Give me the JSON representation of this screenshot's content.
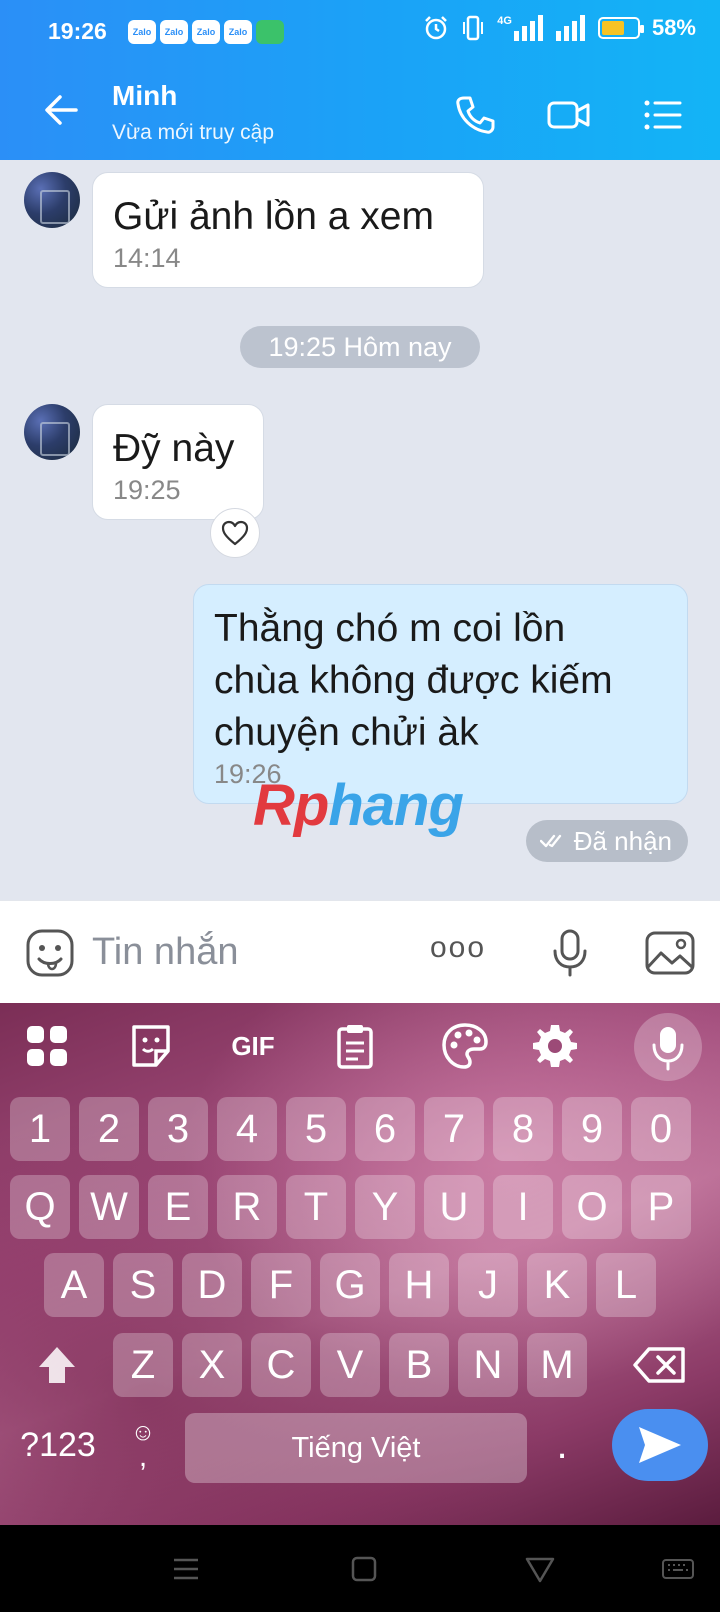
{
  "status_bar": {
    "time": "19:26",
    "notification_apps": [
      "Zalo",
      "Zalo",
      "Zalo",
      "Zalo"
    ],
    "network": "4G",
    "battery": "58%",
    "battery_level": 0.58
  },
  "header": {
    "contact_name": "Minh",
    "contact_status": "Vừa mới truy cập",
    "icons": [
      "back-arrow-icon",
      "phone-icon",
      "video-call-icon",
      "menu-list-icon"
    ]
  },
  "chat": {
    "messages": [
      {
        "direction": "incoming",
        "text": "Gửi ảnh lồn a xem",
        "time": "14:14"
      },
      {
        "direction": "incoming",
        "text": "Đỹ này",
        "time": "19:25"
      },
      {
        "direction": "outgoing",
        "text_lines": [
          "Thằng chó m coi lồn",
          "chùa không được kiếm",
          "chuyện chửi àk"
        ],
        "time": "19:26"
      }
    ],
    "day_separator": "19:25 Hôm nay",
    "delivery_status": "Đã nhận"
  },
  "watermark": {
    "part1": "Rp",
    "part2": "hang"
  },
  "composer": {
    "placeholder": "Tin nhắn",
    "more_dots": "ooo"
  },
  "keyboard": {
    "toolbar": [
      "apps-grid-icon",
      "sticker-icon",
      "GIF",
      "clipboard-icon",
      "palette-icon",
      "settings-gear-icon",
      "mic-icon"
    ],
    "gif_label": "GIF",
    "rows": [
      [
        "1",
        "2",
        "3",
        "4",
        "5",
        "6",
        "7",
        "8",
        "9",
        "0"
      ],
      [
        "Q",
        "W",
        "E",
        "R",
        "T",
        "Y",
        "U",
        "I",
        "O",
        "P"
      ],
      [
        "A",
        "S",
        "D",
        "F",
        "G",
        "H",
        "J",
        "K",
        "L"
      ],
      [
        "Z",
        "X",
        "C",
        "V",
        "B",
        "N",
        "M"
      ]
    ],
    "symbols_key": "?123",
    "comma_key": ",",
    "space_label": "Tiếng Việt",
    "period_key": "."
  }
}
